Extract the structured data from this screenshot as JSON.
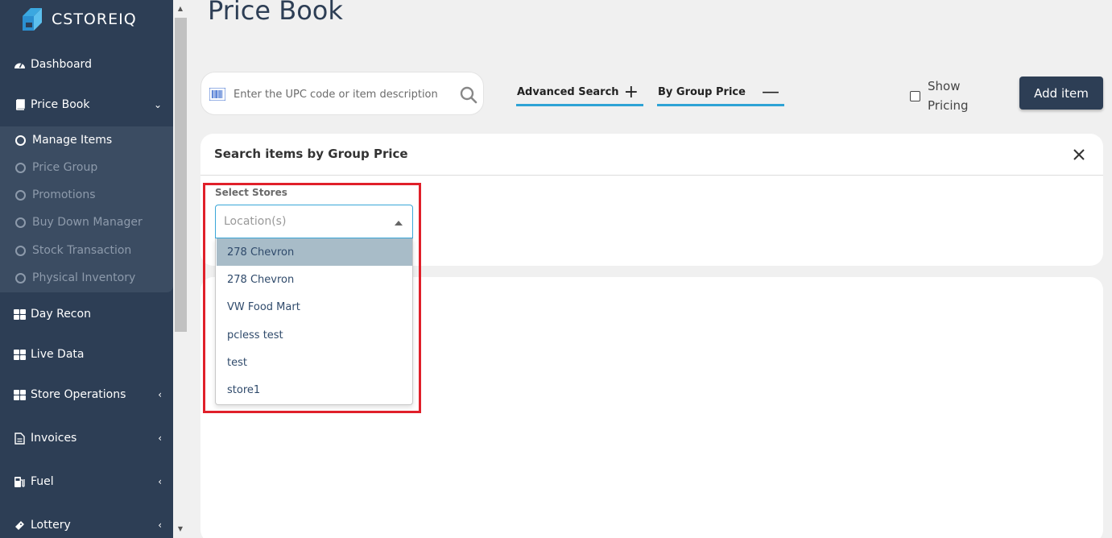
{
  "brand": {
    "name": "CSTOREIQ"
  },
  "sidebar": {
    "items": [
      {
        "label": "Dashboard",
        "icon": "dashboard-icon"
      },
      {
        "label": "Price Book",
        "icon": "book-icon",
        "chevron": "chevron-down"
      },
      {
        "label": "Day Recon",
        "icon": "grid-icon"
      },
      {
        "label": "Live Data",
        "icon": "grid-icon"
      },
      {
        "label": "Store Operations",
        "icon": "grid-icon",
        "chevron": "chevron-left"
      },
      {
        "label": "Invoices",
        "icon": "document-icon",
        "chevron": "chevron-left"
      },
      {
        "label": "Fuel",
        "icon": "fuel-pump-icon",
        "chevron": "chevron-left"
      },
      {
        "label": "Lottery",
        "icon": "ticket-icon",
        "chevron": "chevron-left"
      }
    ],
    "submenu": [
      {
        "label": "Manage Items",
        "active": true
      },
      {
        "label": "Price Group"
      },
      {
        "label": "Promotions"
      },
      {
        "label": "Buy Down Manager"
      },
      {
        "label": "Stock Transaction"
      },
      {
        "label": "Physical Inventory"
      }
    ]
  },
  "page": {
    "title": "Price Book"
  },
  "search": {
    "placeholder": "Enter the UPC code or item description"
  },
  "tabs": [
    {
      "label": "Advanced Search",
      "sign": "+"
    },
    {
      "label": "By Group Price",
      "sign": "—"
    }
  ],
  "show_pricing": {
    "line1": "Show",
    "line2": "Pricing",
    "checked": false
  },
  "add_button": {
    "label": "Add item"
  },
  "panel": {
    "title": "Search items by Group Price",
    "store_label": "Select Stores",
    "store_placeholder": "Location(s)",
    "options": [
      "278 Chevron",
      "278 Chevron",
      "VW Food Mart",
      "pcless test",
      "test",
      "store1"
    ],
    "highlighted_index": 0
  },
  "colors": {
    "sidebar_bg": "#2d3e55",
    "accent": "#2ea3d5",
    "highlight_box": "#e0202a",
    "button_bg": "#2d3e55"
  }
}
